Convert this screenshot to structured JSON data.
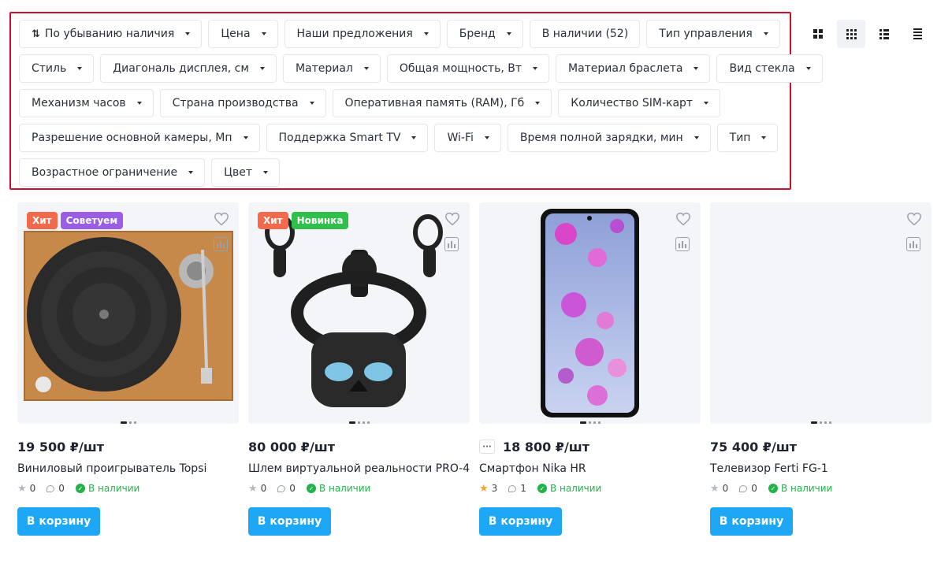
{
  "filters": {
    "sort_label": "По убыванию наличия",
    "row1": [
      "Цена",
      "Наши предложения",
      "Бренд",
      "В наличии (52)",
      "Тип управления"
    ],
    "row2": [
      "Стиль",
      "Диагональ дисплея, см",
      "Материал",
      "Общая мощность, Вт",
      "Материал браслета",
      "Вид стекла"
    ],
    "row3": [
      "Механизм часов",
      "Страна производства",
      "Оперативная память (RAM), Гб",
      "Количество SIM-карт"
    ],
    "row4": [
      "Разрешение основной камеры, Мп",
      "Поддержка Smart TV",
      "Wi-Fi",
      "Время полной зарядки, мин",
      "Тип"
    ],
    "row5": [
      "Возрастное ограничение",
      "Цвет"
    ]
  },
  "view_modes": [
    "grid-large-icon",
    "grid-small-icon",
    "list-icon",
    "lines-icon"
  ],
  "accent_color": "#1ea7f5",
  "badge_colors": {
    "Хит": "#f26a4b",
    "Советуем": "#9b5de5",
    "Новинка": "#2fbf4a"
  },
  "products": [
    {
      "price": "19 500 ₽/шт",
      "name": "Виниловый проигрыватель Topsi",
      "rating": "0",
      "reviews": "0",
      "stock": "В наличии",
      "badges": [
        "Хит",
        "Советуем"
      ],
      "cart": "В корзину",
      "image": "turntable"
    },
    {
      "price": "80 000 ₽/шт",
      "name": "Шлем виртуальной реальности PRO-4",
      "rating": "0",
      "reviews": "0",
      "stock": "В наличии",
      "badges": [
        "Хит",
        "Новинка"
      ],
      "cart": "В корзину",
      "image": "vr-headset"
    },
    {
      "price": "18 800 ₽/шт",
      "name": "Смартфон Nika HR",
      "rating": "3",
      "reviews": "1",
      "stock": "В наличии",
      "badges": [],
      "cart": "В корзину",
      "image": "smartphone"
    },
    {
      "price": "75 400 ₽/шт",
      "name": "Телевизор Ferti FG-1",
      "rating": "0",
      "reviews": "0",
      "stock": "В наличии",
      "badges": [],
      "cart": "В корзину",
      "image": "empty"
    }
  ]
}
